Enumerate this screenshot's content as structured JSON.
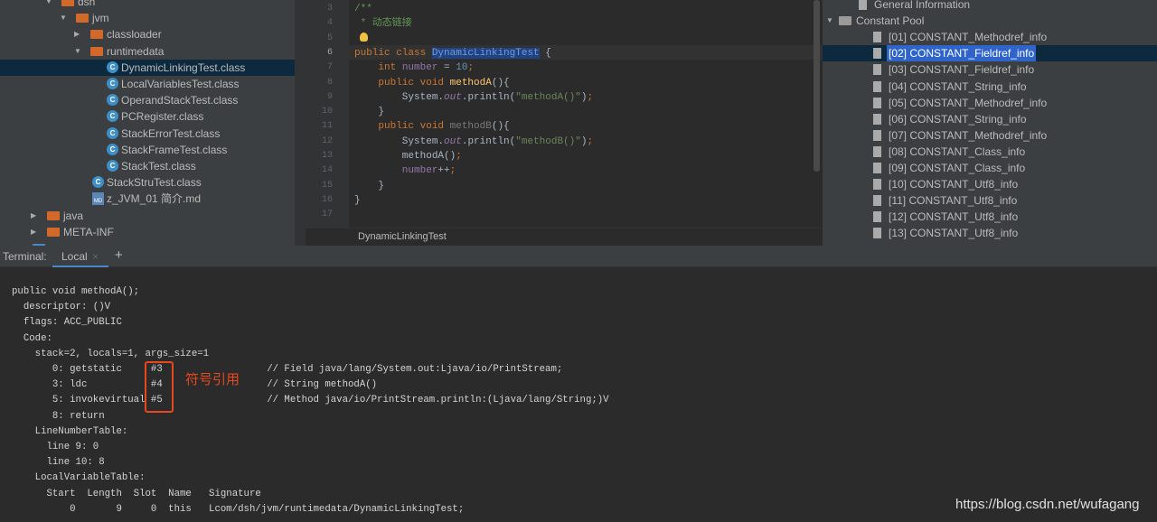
{
  "project_tree": [
    {
      "label": "dsh",
      "type": "folder",
      "indent": 3,
      "expanded": true
    },
    {
      "label": "jvm",
      "type": "folder",
      "indent": 4,
      "expanded": true
    },
    {
      "label": "classloader",
      "type": "folder",
      "indent": 5,
      "expanded": false
    },
    {
      "label": "runtimedata",
      "type": "folder",
      "indent": 5,
      "expanded": true
    },
    {
      "label": "DynamicLinkingTest.class",
      "type": "class",
      "indent": 6,
      "selected": true
    },
    {
      "label": "LocalVariablesTest.class",
      "type": "class",
      "indent": 6
    },
    {
      "label": "OperandStackTest.class",
      "type": "class",
      "indent": 6
    },
    {
      "label": "PCRegister.class",
      "type": "class",
      "indent": 6
    },
    {
      "label": "StackErrorTest.class",
      "type": "class",
      "indent": 6
    },
    {
      "label": "StackFrameTest.class",
      "type": "class",
      "indent": 6
    },
    {
      "label": "StackTest.class",
      "type": "class",
      "indent": 6
    },
    {
      "label": "StackStruTest.class",
      "type": "class",
      "indent": 5
    },
    {
      "label": "z_JVM_01 简介.md",
      "type": "md",
      "indent": 5
    },
    {
      "label": "java",
      "type": "folder",
      "indent": 2,
      "expanded": false
    },
    {
      "label": "META-INF",
      "type": "folder",
      "indent": 2,
      "expanded": false
    },
    {
      "label": "src",
      "type": "folder-blue",
      "indent": 1,
      "expanded": true
    }
  ],
  "editor": {
    "breadcrumb": "DynamicLinkingTest",
    "current_line": 6,
    "lines": [
      {
        "n": 3,
        "tokens": [
          {
            "t": "cm",
            "v": "/**"
          }
        ]
      },
      {
        "n": 4,
        "tokens": [
          {
            "t": "cm",
            "v": " * 动态链接"
          }
        ]
      },
      {
        "n": 5,
        "tokens": [
          {
            "t": "cm",
            "v": " "
          }
        ]
      },
      {
        "n": 6,
        "tokens": [
          {
            "t": "kw",
            "v": "public class "
          },
          {
            "t": "hl",
            "v": "DynamicLinkingTest"
          },
          {
            "t": "",
            "v": " {"
          }
        ]
      },
      {
        "n": 7,
        "tokens": [
          {
            "t": "kw",
            "v": "    int "
          },
          {
            "t": "fld",
            "v": "number"
          },
          {
            "t": "",
            "v": " = "
          },
          {
            "t": "num",
            "v": "10"
          },
          {
            "t": "kw",
            "v": ";"
          }
        ]
      },
      {
        "n": 8,
        "tokens": [
          {
            "t": "kw",
            "v": "    public void "
          },
          {
            "t": "fn",
            "v": "methodA"
          },
          {
            "t": "",
            "v": "(){"
          }
        ]
      },
      {
        "n": 9,
        "tokens": [
          {
            "t": "",
            "v": "        System."
          },
          {
            "t": "it",
            "v": "out"
          },
          {
            "t": "",
            "v": ".println("
          },
          {
            "t": "str",
            "v": "\"methodA()\""
          },
          {
            "t": "",
            "v": ")"
          },
          {
            "t": "kw",
            "v": ";"
          }
        ]
      },
      {
        "n": 10,
        "tokens": [
          {
            "t": "",
            "v": "    }"
          }
        ]
      },
      {
        "n": 11,
        "tokens": [
          {
            "t": "kw",
            "v": "    public void "
          },
          {
            "t": "unused",
            "v": "methodB"
          },
          {
            "t": "",
            "v": "(){"
          }
        ]
      },
      {
        "n": 12,
        "tokens": [
          {
            "t": "",
            "v": "        System."
          },
          {
            "t": "it",
            "v": "out"
          },
          {
            "t": "",
            "v": ".println("
          },
          {
            "t": "str",
            "v": "\"methodB()\""
          },
          {
            "t": "",
            "v": ")"
          },
          {
            "t": "kw",
            "v": ";"
          }
        ]
      },
      {
        "n": 13,
        "tokens": [
          {
            "t": "",
            "v": "        methodA()"
          },
          {
            "t": "kw",
            "v": ";"
          }
        ]
      },
      {
        "n": 14,
        "tokens": [
          {
            "t": "fld",
            "v": "        number"
          },
          {
            "t": "",
            "v": "++"
          },
          {
            "t": "kw",
            "v": ";"
          }
        ]
      },
      {
        "n": 15,
        "tokens": [
          {
            "t": "",
            "v": "    }"
          }
        ]
      },
      {
        "n": 16,
        "tokens": [
          {
            "t": "",
            "v": "}"
          }
        ]
      },
      {
        "n": 17,
        "tokens": []
      }
    ]
  },
  "class_structure": [
    {
      "label": "General Information",
      "type": "file",
      "indent": 1
    },
    {
      "label": "Constant Pool",
      "type": "folder",
      "indent": 0,
      "expanded": true
    },
    {
      "label": "[01] CONSTANT_Methodref_info",
      "type": "file",
      "indent": 2
    },
    {
      "label": "[02] CONSTANT_Fieldref_info",
      "type": "file",
      "indent": 2,
      "selected": true
    },
    {
      "label": "[03] CONSTANT_Fieldref_info",
      "type": "file",
      "indent": 2
    },
    {
      "label": "[04] CONSTANT_String_info",
      "type": "file",
      "indent": 2
    },
    {
      "label": "[05] CONSTANT_Methodref_info",
      "type": "file",
      "indent": 2
    },
    {
      "label": "[06] CONSTANT_String_info",
      "type": "file",
      "indent": 2
    },
    {
      "label": "[07] CONSTANT_Methodref_info",
      "type": "file",
      "indent": 2
    },
    {
      "label": "[08] CONSTANT_Class_info",
      "type": "file",
      "indent": 2
    },
    {
      "label": "[09] CONSTANT_Class_info",
      "type": "file",
      "indent": 2
    },
    {
      "label": "[10] CONSTANT_Utf8_info",
      "type": "file",
      "indent": 2
    },
    {
      "label": "[11] CONSTANT_Utf8_info",
      "type": "file",
      "indent": 2
    },
    {
      "label": "[12] CONSTANT_Utf8_info",
      "type": "file",
      "indent": 2
    },
    {
      "label": "[13] CONSTANT_Utf8_info",
      "type": "file",
      "indent": 2
    }
  ],
  "terminal": {
    "title": "Terminal:",
    "tab": "Local",
    "close": "×",
    "add": "+",
    "lines": [
      "public void methodA();",
      "  descriptor: ()V",
      "  flags: ACC_PUBLIC",
      "  Code:",
      "    stack=2, locals=1, args_size=1",
      "       0: getstatic     #3                  // Field java/lang/System.out:Ljava/io/PrintStream;",
      "       3: ldc           #4                  // String methodA()",
      "       5: invokevirtual #5                  // Method java/io/PrintStream.println:(Ljava/lang/String;)V",
      "       8: return",
      "    LineNumberTable:",
      "      line 9: 0",
      "      line 10: 8",
      "    LocalVariableTable:",
      "      Start  Length  Slot  Name   Signature",
      "          0       9     0  this   Lcom/dsh/jvm/runtimedata/DynamicLinkingTest;"
    ]
  },
  "annotation": {
    "label": "符号引用",
    "color": "#e8481c"
  },
  "watermark": "https://blog.csdn.net/wufagang"
}
